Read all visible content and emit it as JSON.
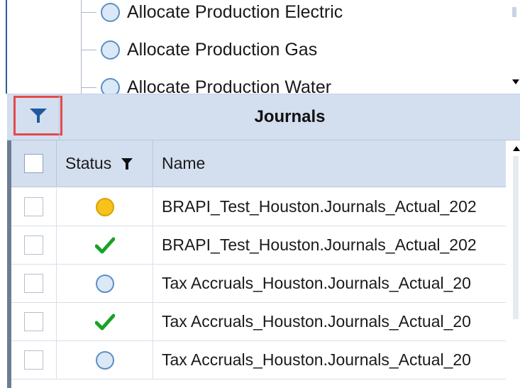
{
  "tree": {
    "items": [
      {
        "label": "Allocate Production Electric"
      },
      {
        "label": "Allocate Production Gas"
      },
      {
        "label": "Allocate Production Water"
      }
    ]
  },
  "header": {
    "title": "Journals",
    "filter_icon": "filter-icon"
  },
  "grid": {
    "columns": {
      "status": "Status",
      "name": "Name"
    },
    "rows": [
      {
        "status": "pending",
        "name": "BRAPI_Test_Houston.Journals_Actual_202"
      },
      {
        "status": "complete",
        "name": "BRAPI_Test_Houston.Journals_Actual_202"
      },
      {
        "status": "none",
        "name": "Tax Accruals_Houston.Journals_Actual_20"
      },
      {
        "status": "complete",
        "name": "Tax Accruals_Houston.Journals_Actual_20"
      },
      {
        "status": "none",
        "name": "Tax Accruals_Houston.Journals_Actual_20"
      }
    ]
  },
  "colors": {
    "header_bg": "#d3deef",
    "filter_highlight": "#e24a4a",
    "filter_icon": "#1f5aa0",
    "check_green": "#17a325",
    "pending_yellow": "#f7c21c",
    "none_blue": "#dbe8f6"
  }
}
